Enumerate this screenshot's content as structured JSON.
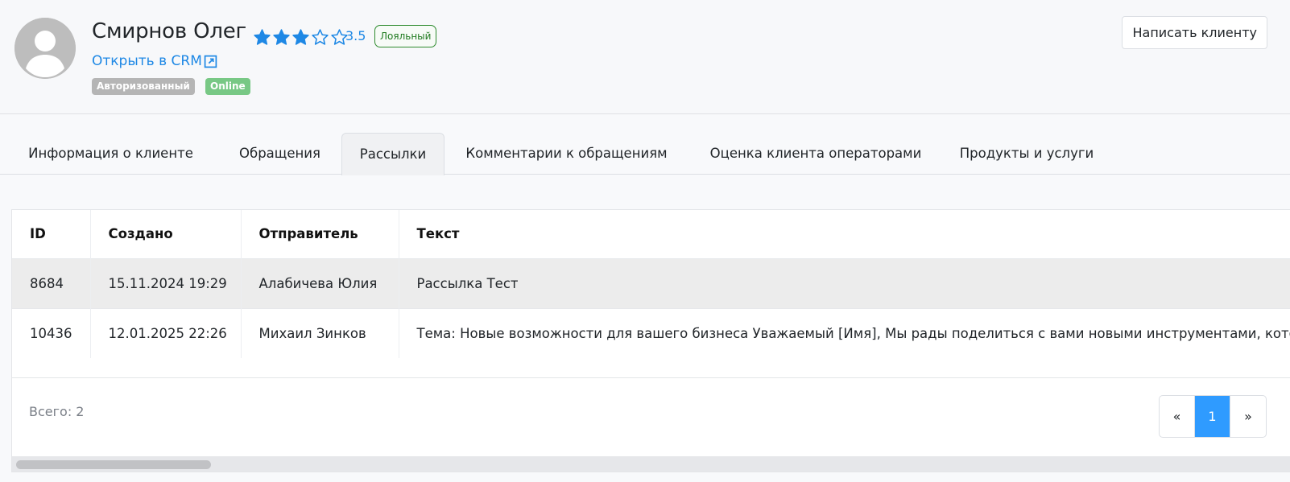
{
  "client": {
    "name": "Смирнов Олег",
    "rating_value": "3.5",
    "rating": 3.5,
    "rating_max": 5,
    "loyalty_badge": "Лояльный",
    "crm_link_label": "Открыть в CRM",
    "tags": [
      "Авторизованный",
      "Online"
    ]
  },
  "actions": {
    "write_button": "Написать клиенту"
  },
  "tabs": [
    {
      "label": "Информация о клиенте",
      "active": false
    },
    {
      "label": "Обращения",
      "active": false
    },
    {
      "label": "Рассылки",
      "active": true
    },
    {
      "label": "Комментарии к обращениям",
      "active": false
    },
    {
      "label": "Оценка клиента операторами",
      "active": false
    },
    {
      "label": "Продукты и услуги",
      "active": false
    }
  ],
  "table": {
    "columns": [
      "ID",
      "Создано",
      "Отправитель",
      "Текст"
    ],
    "rows": [
      {
        "id": "8684",
        "created": "15.11.2024 19:29",
        "sender": "Алабичева Юлия",
        "text": "Рассылка Тест",
        "highlighted": true
      },
      {
        "id": "10436",
        "created": "12.01.2025 22:26",
        "sender": "Михаил Зинков",
        "text": "Тема: Новые возможности для вашего бизнеса Уважаемый [Имя], Мы рады поделиться с вами новыми инструментами, которые",
        "highlighted": false
      }
    ],
    "total_label": "Всего: 2"
  },
  "pagination": {
    "prev": "«",
    "current": "1",
    "next": "»"
  },
  "colors": {
    "accent": "#1e88e5",
    "star": "#1e88e5",
    "loyal_badge": "#2e8b2e",
    "tag_auth": "#b5b5b5",
    "tag_online": "#78c885",
    "page_active": "#2f9bff"
  },
  "icons": {
    "avatar": "user-avatar-icon",
    "star_filled": "star-filled-icon",
    "star_empty": "star-outline-icon",
    "external_link": "external-link-icon"
  }
}
